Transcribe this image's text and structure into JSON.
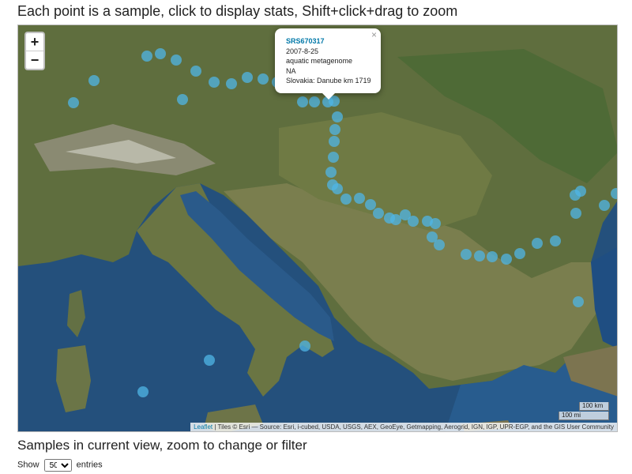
{
  "header": {
    "title": "Each point is a sample, click to display stats, Shift+click+drag to zoom"
  },
  "map": {
    "zoom_in_label": "+",
    "zoom_out_label": "−",
    "popup": {
      "close_label": "×",
      "sample_id": "SRS670317",
      "date": "2007-8-25",
      "metagenome": "aquatic metagenome",
      "extra": "NA",
      "location": "Slovakia: Danube km 1719"
    },
    "scale_km": "100 km",
    "scale_mi": "100 mi",
    "attribution_leaflet": "Leaflet",
    "attribution_text": " | Tiles © Esri — Source: Esri, i-cubed, USDA, USGS, AEX, GeoEye, Getmapping, Aerogrid, IGN, IGP, UPR-EGP, and the GIS User Community",
    "marker_color": "#4fb5e6"
  },
  "table": {
    "heading": "Samples in current view, zoom to change or filter",
    "show_label": "Show",
    "page_size": "50",
    "entries_label": "entries"
  }
}
